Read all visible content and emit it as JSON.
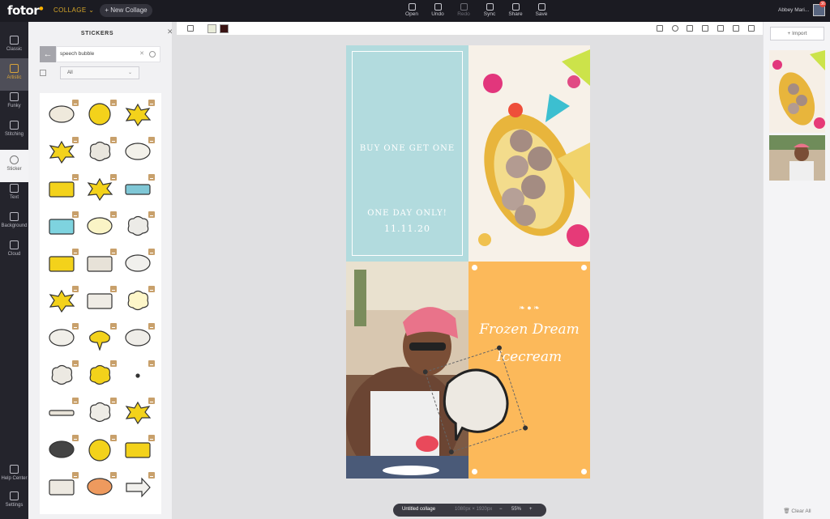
{
  "app": {
    "logo": "fotor",
    "mode_label": "COLLAGE",
    "new_collage_label": "New Collage"
  },
  "toolbar": [
    {
      "id": "open",
      "label": "Open",
      "disabled": false
    },
    {
      "id": "undo",
      "label": "Undo",
      "disabled": false
    },
    {
      "id": "redo",
      "label": "Redo",
      "disabled": true
    },
    {
      "id": "sync",
      "label": "Sync",
      "disabled": false
    },
    {
      "id": "share",
      "label": "Share",
      "disabled": false
    },
    {
      "id": "save",
      "label": "Save",
      "disabled": false
    }
  ],
  "user": {
    "name": "Abbey Mari...",
    "notifications": "36"
  },
  "rail": [
    {
      "label": "Classic",
      "icon": "grid-icon",
      "state": ""
    },
    {
      "label": "Artistic",
      "icon": "artistic-icon",
      "state": "artistic"
    },
    {
      "label": "Funky",
      "icon": "funky-icon",
      "state": ""
    },
    {
      "label": "Stitching",
      "icon": "stitching-icon",
      "state": ""
    },
    {
      "label": "Sticker",
      "icon": "sticker-icon",
      "state": "active"
    },
    {
      "label": "Text",
      "icon": "text-icon",
      "state": ""
    },
    {
      "label": "Background",
      "icon": "background-icon",
      "state": ""
    },
    {
      "label": "Cloud",
      "icon": "cloud-icon",
      "state": ""
    },
    {
      "label": "Help Center",
      "icon": "help-icon",
      "state": ""
    },
    {
      "label": "Settings",
      "icon": "settings-icon",
      "state": ""
    }
  ],
  "stickers_panel": {
    "title": "STICKERS",
    "search_value": "speech bubble",
    "filter_value": "All",
    "items": [
      {
        "shape": "oval",
        "fill": "#efe9dc"
      },
      {
        "shape": "megaphone",
        "fill": "#f3d21b"
      },
      {
        "shape": "burst",
        "fill": "#f3d21b"
      },
      {
        "shape": "burst",
        "fill": "#f3d21b"
      },
      {
        "shape": "cloud",
        "fill": "#e9e6de"
      },
      {
        "shape": "oval",
        "fill": "#f3f1ea"
      },
      {
        "shape": "rect",
        "fill": "#f3d21b"
      },
      {
        "shape": "burst",
        "fill": "#f3d21b"
      },
      {
        "shape": "tags",
        "fill": "#7fc7d6"
      },
      {
        "shape": "rect",
        "fill": "#7ed3df"
      },
      {
        "shape": "oval",
        "fill": "#faf4c6"
      },
      {
        "shape": "cloud",
        "fill": "#ecebe7"
      },
      {
        "shape": "rect",
        "fill": "#f3d21b"
      },
      {
        "shape": "rect",
        "fill": "#e7e2d8"
      },
      {
        "shape": "oval",
        "fill": "#f1f0ed"
      },
      {
        "shape": "burst",
        "fill": "#f3d21b"
      },
      {
        "shape": "rect",
        "fill": "#efece5"
      },
      {
        "shape": "cloud",
        "fill": "#fdf6c9"
      },
      {
        "shape": "oval",
        "fill": "#f1efe9"
      },
      {
        "shape": "drip",
        "fill": "#f3d21b"
      },
      {
        "shape": "oval",
        "fill": "#efede8"
      },
      {
        "shape": "cloud",
        "fill": "#ece9e2"
      },
      {
        "shape": "cloud",
        "fill": "#f3d21b"
      },
      {
        "shape": "dots",
        "fill": "#333333"
      },
      {
        "shape": "bar",
        "fill": "#e8e3d8"
      },
      {
        "shape": "cloud",
        "fill": "#eeece6"
      },
      {
        "shape": "burst",
        "fill": "#f3d21b"
      },
      {
        "shape": "oval",
        "fill": "#444444"
      },
      {
        "shape": "circle",
        "fill": "#f3d21b"
      },
      {
        "shape": "rect",
        "fill": "#f3d21b"
      },
      {
        "shape": "rect",
        "fill": "#ede9e1"
      },
      {
        "shape": "oval",
        "fill": "#ee9a5e"
      },
      {
        "shape": "arrow",
        "fill": "#f1f0ed"
      }
    ]
  },
  "canvas": {
    "cell_a": {
      "line1": "BUY ONE GET ONE",
      "line2": "ONE DAY ONLY!",
      "line3": "11.11.20"
    },
    "cell_d": {
      "line1": "Frozen Dream",
      "line2": "Icecream"
    },
    "colors": {
      "cell_a_bg": "#b2dbde",
      "cell_d_bg": "#fcb95a"
    }
  },
  "context_bar": {
    "swatch_1": "#e9ecd9",
    "swatch_2": "#3a1414"
  },
  "bottom_bar": {
    "name": "Untitled collage",
    "size": "1080px × 1920px",
    "zoom": "55%"
  },
  "right_panel": {
    "import_label": "Import",
    "clear_label": "Clear All"
  }
}
